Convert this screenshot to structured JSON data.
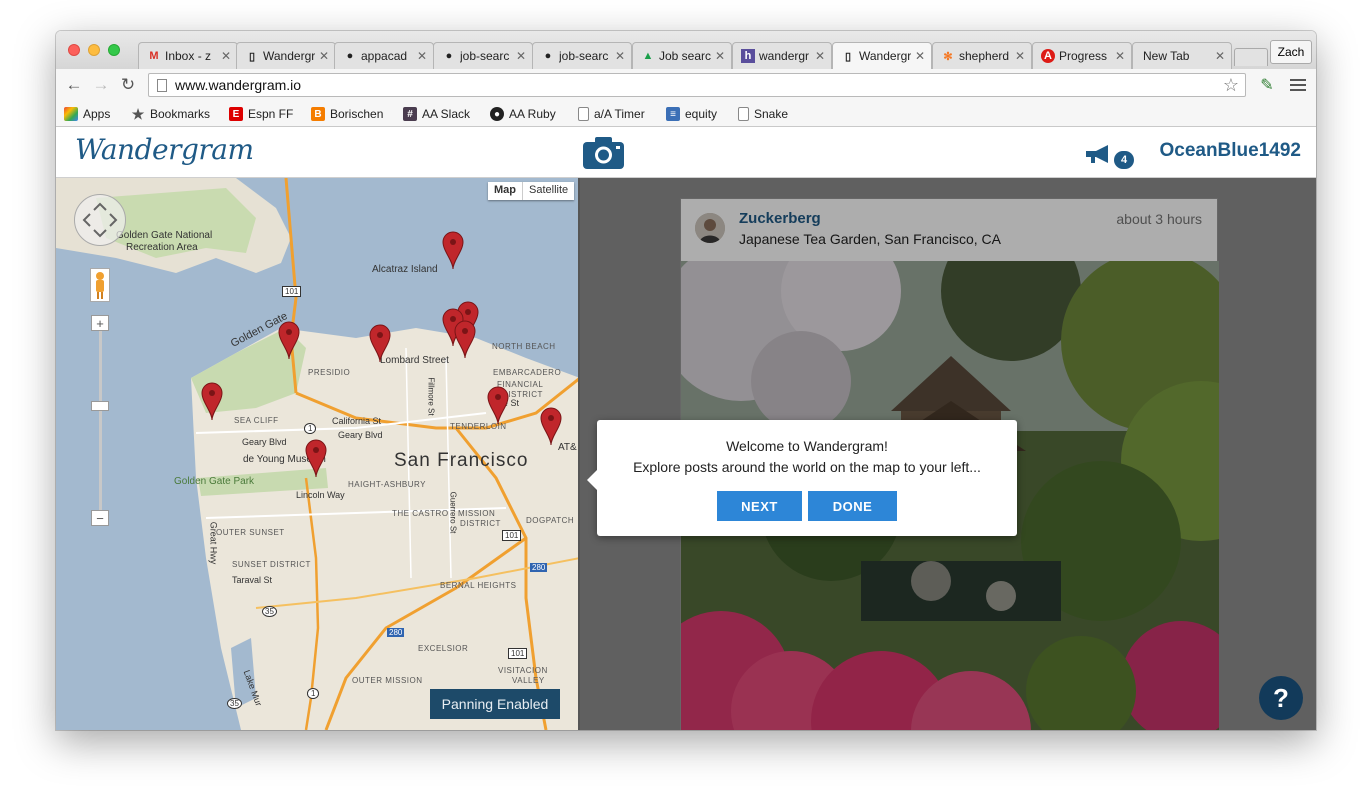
{
  "browser": {
    "tabs": [
      {
        "title": "Inbox - z",
        "icon": "gmail-icon"
      },
      {
        "title": "Wandergr",
        "icon": "page-icon"
      },
      {
        "title": "appacad",
        "icon": "github-icon"
      },
      {
        "title": "job-searc",
        "icon": "github-icon"
      },
      {
        "title": "job-searc",
        "icon": "github-icon"
      },
      {
        "title": "Job searc",
        "icon": "drive-icon"
      },
      {
        "title": "wandergr",
        "icon": "heroku-icon"
      },
      {
        "title": "Wandergr",
        "icon": "page-icon"
      },
      {
        "title": "shepherd",
        "icon": "hubspot-icon"
      },
      {
        "title": "Progress",
        "icon": "angular-icon"
      },
      {
        "title": "New Tab",
        "icon": ""
      }
    ],
    "profile_label": "Zach",
    "url": "www.wandergram.io",
    "bookmarks": [
      {
        "label": "Apps"
      },
      {
        "label": "Bookmarks"
      },
      {
        "label": "Espn FF"
      },
      {
        "label": "Borischen"
      },
      {
        "label": "AA Slack"
      },
      {
        "label": "AA Ruby"
      },
      {
        "label": "a/A Timer"
      },
      {
        "label": "equity"
      },
      {
        "label": "Snake"
      }
    ]
  },
  "app": {
    "logo": "Wandergram",
    "notification_count": "4",
    "username": "OceanBlue1492",
    "accent": "#1f5a86"
  },
  "map": {
    "type_map": "Map",
    "type_satellite": "Satellite",
    "labels": {
      "golden_gate_recreation": "Golden Gate National",
      "recreation_area": "Recreation Area",
      "alcatraz": "Alcatraz Island",
      "golden_gate": "Golden Gate",
      "lombard": "Lombard Street",
      "presidio": "PRESIDIO",
      "north_beach": "NORTH BEACH",
      "embarcadero": "EMBARCADERO",
      "financial": "FINANCIAL",
      "district": "DISTRICT",
      "sea_cliff": "SEA CLIFF",
      "california_st": "California St",
      "geary_blvd_1": "Geary Blvd",
      "geary_blvd_2": "Geary Blvd",
      "pine_st": "Pine St",
      "tenderloin": "TENDERLOIN",
      "att": "AT&",
      "de_young": "de Young Museum",
      "san_francisco": "San Francisco",
      "ggpark": "Golden Gate Park",
      "lincoln_way": "Lincoln Way",
      "haight": "HAIGHT-ASHBURY",
      "castro": "THE CASTRO",
      "mission": "MISSION",
      "mission_district": "DISTRICT",
      "dogpatch": "DOGPATCH",
      "outer_sunset": "OUTER SUNSET",
      "sunset_district": "SUNSET DISTRICT",
      "taraval": "Taraval St",
      "great_hwy": "Great Hwy",
      "bernal": "BERNAL HEIGHTS",
      "excelsior": "EXCELSIOR",
      "outer_mission": "OUTER MISSION",
      "visitacion": "VISITACION",
      "valley": "VALLEY",
      "lake_merced": "Lake Mur",
      "filmore": "Fillmore St",
      "guerrero": "Guerrero St",
      "us101_a": "101",
      "us101_b": "101",
      "us101_c": "101",
      "ca1_a": "1",
      "ca1_b": "1",
      "i280_a": "280",
      "i280_b": "280",
      "ca35_a": "35",
      "ca35_b": "35"
    },
    "panning_label": "Panning Enabled"
  },
  "post": {
    "author": "Zuckerberg",
    "location": "Japanese Tea Garden, San Francisco, CA",
    "time": "about 3 hours"
  },
  "tour": {
    "title": "Welcome to Wandergram!",
    "body": "Explore posts around the world on the map to your left...",
    "next_label": "NEXT",
    "done_label": "DONE"
  },
  "help_label": "?"
}
